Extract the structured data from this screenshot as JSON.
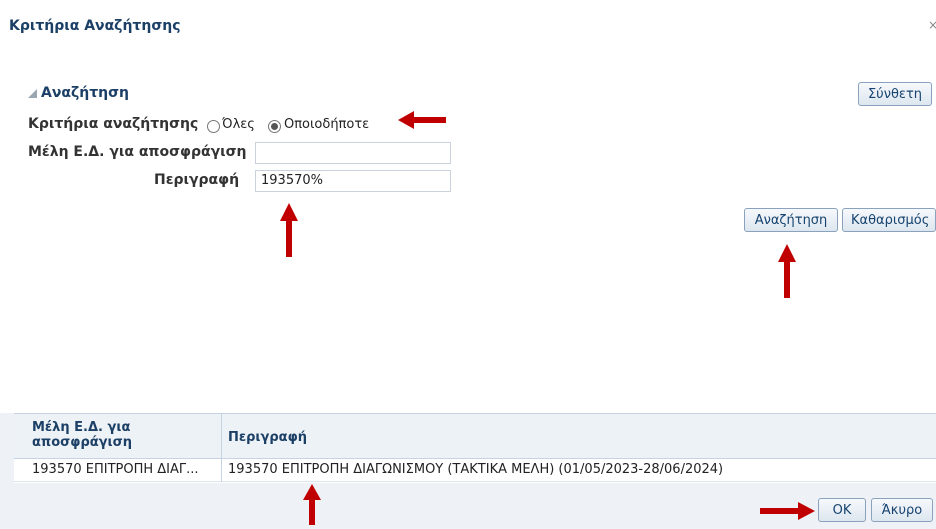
{
  "dialog": {
    "title": "Κριτήρια Αναζήτησης",
    "close_glyph": "×"
  },
  "search": {
    "section_title": "Αναζήτηση",
    "advanced_button": "Σύνθετη",
    "criteria_label": "Κριτήρια αναζήτησης",
    "option_all": "Όλες",
    "option_any": "Οποιοδήποτε",
    "selected_option": "Οποιοδήποτε",
    "members_label": "Μέλη Ε.Δ. για αποσφράγιση",
    "members_value": "",
    "description_label": "Περιγραφή",
    "description_value": "193570%",
    "search_button": "Αναζήτηση",
    "reset_button": "Καθαρισμός"
  },
  "results": {
    "columns": [
      "Μέλη Ε.Δ. για αποσφράγιση",
      "Περιγραφή"
    ],
    "rows": [
      [
        "193570 ΕΠΙΤΡΟΠΗ ΔΙΑΓ...",
        "193570 ΕΠΙΤΡΟΠΗ ΔΙΑΓΩΝΙΣΜΟΥ (ΤΑΚΤΙΚΑ ΜΕΛΗ) (01/05/2023-28/06/2024)"
      ]
    ]
  },
  "footer": {
    "ok_button": "OK",
    "cancel_button": "Άκυρο"
  },
  "colors": {
    "annotation_arrow": "#c00000",
    "title_text": "#1c3f66"
  }
}
